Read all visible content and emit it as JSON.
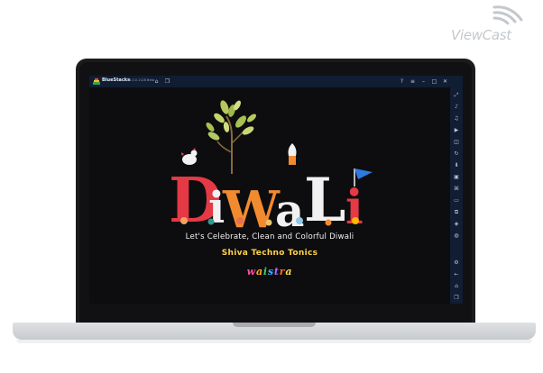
{
  "watermark": {
    "text": "ViewCast"
  },
  "window": {
    "app_name": "BlueStacks",
    "version": "5.0.0.1128 Beta"
  },
  "titlebar": {
    "icons": [
      "home-icon",
      "multi-instance-icon",
      "help-icon",
      "menu-icon",
      "minimize-icon",
      "restore-icon",
      "close-icon"
    ]
  },
  "sidebar": {
    "icons": [
      "fullscreen-icon",
      "volume-up-icon",
      "volume-down-icon",
      "video-icon",
      "screenshot-icon",
      "rotate-icon",
      "install-apk-icon",
      "media-icon",
      "macro-icon",
      "folder-icon",
      "copy-icon",
      "layers-icon",
      "eco-icon",
      "settings-icon",
      "back-icon",
      "home-icon",
      "recents-icon"
    ]
  },
  "app": {
    "title_letters": [
      "D",
      "i",
      "W",
      "a",
      "L",
      "i"
    ],
    "tagline": "Let's Celebrate, Clean and Colorful Diwali",
    "company": "Shiva Techno Tonics",
    "brand_letters": [
      "w",
      "a",
      "i",
      "s",
      "t",
      "r",
      "a"
    ]
  },
  "colors": {
    "titlebar": "#101d33",
    "accent_yellow": "#ffd24a",
    "letter_red": "#e63946",
    "letter_white": "#f1f1f1",
    "letter_orange": "#f28b30",
    "flag_blue": "#2d7be0",
    "brand_palette": [
      "#ff4fa3",
      "#ffb020",
      "#3fd06a",
      "#35b8ff",
      "#b06bff",
      "#ff6a3d",
      "#ffe14a"
    ]
  }
}
